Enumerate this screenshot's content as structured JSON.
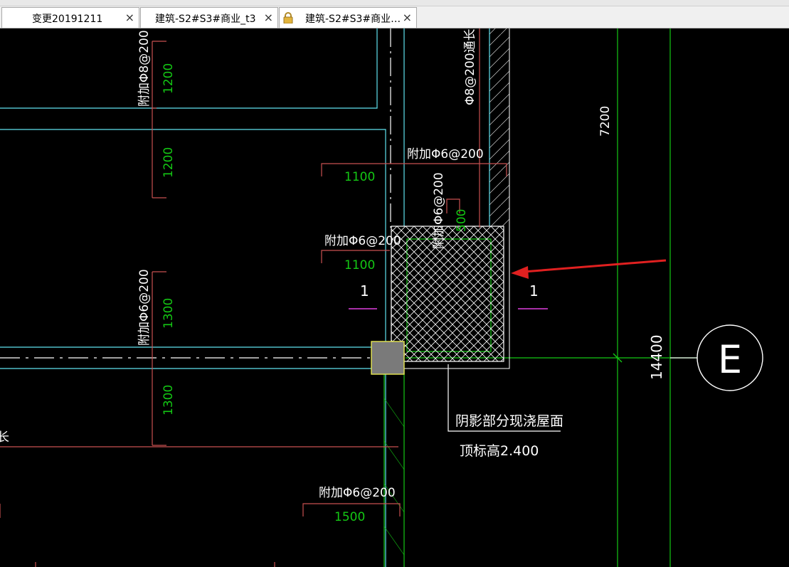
{
  "tabs": [
    {
      "label": "变更20191211",
      "close": "×"
    },
    {
      "label": "建筑-S2#S3#商业_t3",
      "close": "×"
    },
    {
      "label": "建筑-S2#S3#商业…",
      "close": "×"
    }
  ],
  "drawing": {
    "texts": {
      "rebar_top_left": "附加Φ8@200",
      "dim_1200_a": "1200",
      "dim_1200_b": "1200",
      "rebar_through": "Φ8@200通长",
      "dim_7200": "7200",
      "rebar_add_1": "附加Φ6@200",
      "dim_1100_a": "1100",
      "rebar_add_vertical": "附加Φ6@200",
      "dim_500": "500",
      "rebar_add_2": "附加Φ6@200",
      "dim_1100_b": "1100",
      "section_left": "1",
      "section_right": "1",
      "rebar_mid_left": "附加Φ6@200",
      "dim_1300_a": "1300",
      "dim_1300_b": "1300",
      "dim_14400": "14400",
      "axis_e": "E",
      "note_line1": "阴影部分现浇屋面",
      "note_line2": "顶标高2.400",
      "rebar_add_3": "附加Φ6@200",
      "dim_1500": "1500",
      "edge_text": "长"
    }
  },
  "colors": {
    "cyan": "#5fe3ef",
    "green": "#14c814",
    "red": "#c85050",
    "white": "#ffffff",
    "magenta": "#e040e0",
    "arrow": "#e02020",
    "yellow": "#e6e650"
  }
}
